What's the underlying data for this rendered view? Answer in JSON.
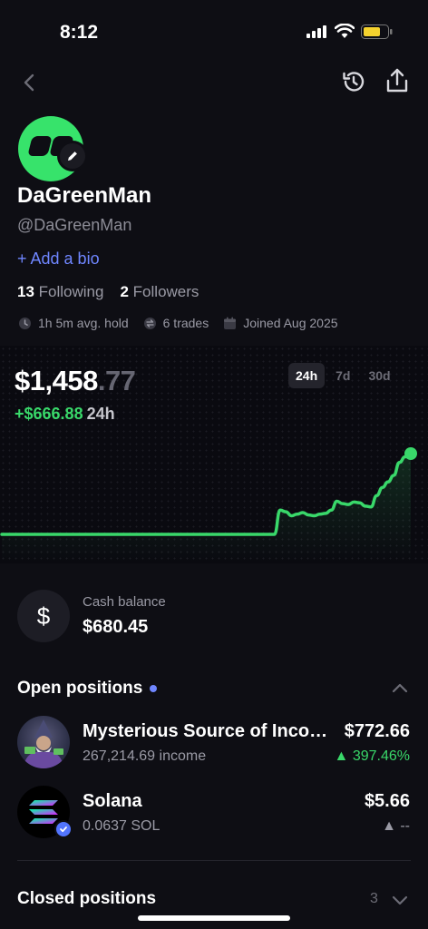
{
  "status_bar": {
    "time": "8:12"
  },
  "profile": {
    "name": "DaGreenMan",
    "handle": "@DaGreenMan",
    "add_bio": "+ Add a bio",
    "following_count": "13",
    "following_label": "Following",
    "followers_count": "2",
    "followers_label": "Followers",
    "avg_hold": "1h 5m avg. hold",
    "trades": "6 trades",
    "joined": "Joined Aug 2025",
    "avatar_color": "#37e36b"
  },
  "portfolio": {
    "value_main": "$1,458",
    "value_cents": ".77",
    "change": "+$666.88",
    "change_period": "24h",
    "ranges": [
      "24h",
      "7d",
      "30d"
    ],
    "active_range": "24h",
    "line_color": "#39d86a"
  },
  "chart_data": {
    "type": "line",
    "series": [
      {
        "values": [
          0,
          0,
          0,
          0,
          0,
          0,
          0,
          0,
          0,
          0,
          0,
          0,
          0,
          0,
          0,
          0,
          0,
          0,
          0,
          0,
          0,
          0,
          0,
          0,
          0,
          0,
          0,
          0,
          0,
          0,
          0,
          0,
          0,
          0,
          0,
          0,
          0,
          0,
          0,
          0,
          0,
          0,
          0,
          0,
          0,
          0,
          0,
          0,
          0,
          30,
          28,
          23,
          25,
          27,
          24,
          23,
          25,
          26,
          30,
          41,
          38,
          37,
          40,
          39,
          35,
          34,
          48,
          58,
          65,
          73,
          89,
          96,
          100
        ]
      }
    ]
  },
  "cash": {
    "label": "Cash balance",
    "value": "$680.45",
    "symbol": "$"
  },
  "open_positions": {
    "title": "Open positions",
    "items": [
      {
        "name": "Mysterious Source of Income",
        "amount": "267,214.69 income",
        "value": "$772.66",
        "change": "▲ 397.46%",
        "direction": "up"
      },
      {
        "name": "Solana",
        "amount": "0.0637 SOL",
        "value": "$5.66",
        "change": "▲ --",
        "direction": "neutral"
      }
    ]
  },
  "closed_positions": {
    "title": "Closed positions",
    "count": "3"
  }
}
